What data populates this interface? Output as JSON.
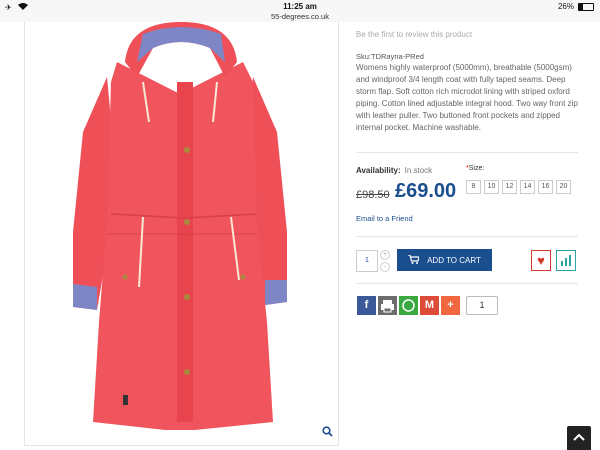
{
  "statusbar": {
    "time": "11:25 am",
    "url": "55-degrees.co.uk",
    "battery": "26%"
  },
  "product": {
    "review_text": "Be the first to review this product",
    "sku": "Sku:TDRayna-PRed",
    "description": "Womens highly waterproof (5000mm), breathable (5000gsm) and windproof 3/4 length coat with fully taped seams. Deep storm flap. Soft cotton rich microdot lining with striped oxford piping. Cotton lined adjustable integral hood. Two way front zip with leather puller. Two buttoned front pockets and zipped internal pocket. Machine washable.",
    "availability_label": "Availability:",
    "availability_value": "In stock",
    "size_required": "*",
    "size_label": "Size:",
    "sizes": [
      "8",
      "10",
      "12",
      "14",
      "16",
      "20"
    ],
    "old_price": "£98.50",
    "new_price": "£69.00",
    "email_friend": "Email to a Friend",
    "quantity": "1",
    "add_to_cart": "ADD TO CART",
    "share_count": "1"
  },
  "colors": {
    "coat": "#f0545c",
    "brand_blue": "#1b4e8f",
    "cuff": "#7f86c6"
  },
  "icons": {
    "zoom": "magnifier-icon",
    "cart": "cart-icon",
    "wishlist": "heart-icon",
    "compare": "bar-chart-icon",
    "facebook": "facebook-icon",
    "print": "print-icon",
    "whatsapp": "whatsapp-icon",
    "gmail": "gmail-icon",
    "more": "plus-icon",
    "scroll_top": "chevron-up-icon"
  }
}
